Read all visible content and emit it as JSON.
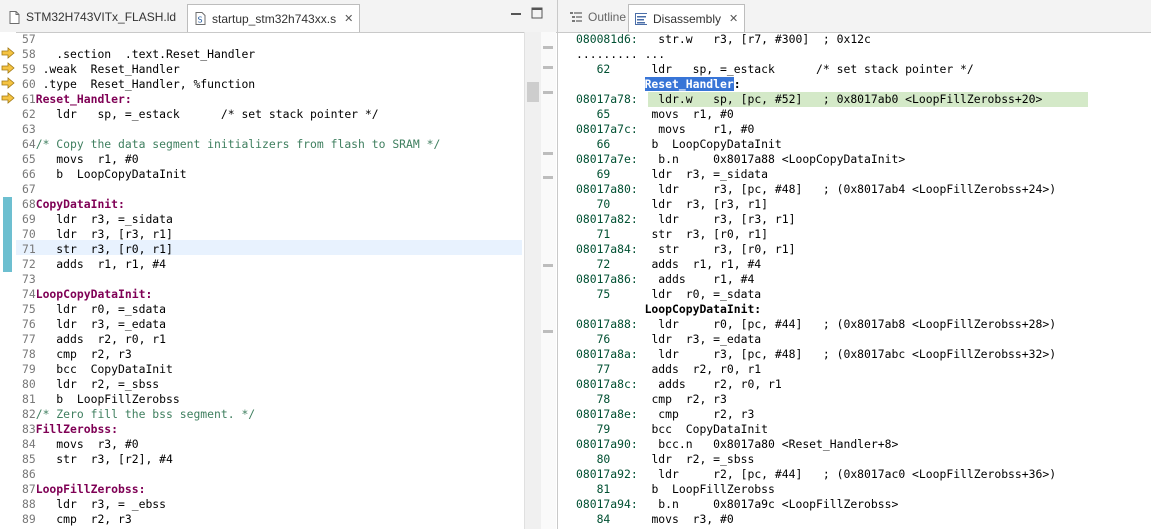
{
  "left": {
    "tabs": [
      {
        "label": "STM32H743VITx_FLASH.ld",
        "active": false
      },
      {
        "label": "startup_stm32h743xx.s",
        "active": true,
        "close": "✕"
      }
    ],
    "lines": [
      {
        "n": "57",
        "t": ""
      },
      {
        "n": "58",
        "t": "  .section  .text.Reset_Handler"
      },
      {
        "n": "59",
        "t": ".weak  Reset_Handler"
      },
      {
        "n": "60",
        "t": ".type  Reset_Handler, %function"
      },
      {
        "n": "61",
        "t": "Reset_Handler:"
      },
      {
        "n": "62",
        "t": "  ldr   sp, =_estack      /* set stack pointer */"
      },
      {
        "n": "63",
        "t": ""
      },
      {
        "n": "64",
        "t": "/* Copy the data segment initializers from flash to SRAM */"
      },
      {
        "n": "65",
        "t": "  movs  r1, #0"
      },
      {
        "n": "66",
        "t": "  b  LoopCopyDataInit"
      },
      {
        "n": "67",
        "t": ""
      },
      {
        "n": "68",
        "t": "CopyDataInit:"
      },
      {
        "n": "69",
        "t": "  ldr  r3, =_sidata"
      },
      {
        "n": "70",
        "t": "  ldr  r3, [r3, r1]"
      },
      {
        "n": "71",
        "t": "  str  r3, [r0, r1]"
      },
      {
        "n": "72",
        "t": "  adds  r1, r1, #4"
      },
      {
        "n": "73",
        "t": ""
      },
      {
        "n": "74",
        "t": "LoopCopyDataInit:"
      },
      {
        "n": "75",
        "t": "  ldr  r0, =_sdata"
      },
      {
        "n": "76",
        "t": "  ldr  r3, =_edata"
      },
      {
        "n": "77",
        "t": "  adds  r2, r0, r1"
      },
      {
        "n": "78",
        "t": "  cmp  r2, r3"
      },
      {
        "n": "79",
        "t": "  bcc  CopyDataInit"
      },
      {
        "n": "80",
        "t": "  ldr  r2, =_sbss"
      },
      {
        "n": "81",
        "t": "  b  LoopFillZerobss"
      },
      {
        "n": "82",
        "t": "/* Zero fill the bss segment. */"
      },
      {
        "n": "83",
        "t": "FillZerobss:"
      },
      {
        "n": "84",
        "t": "  movs  r3, #0"
      },
      {
        "n": "85",
        "t": "  str  r3, [r2], #4"
      },
      {
        "n": "86",
        "t": ""
      },
      {
        "n": "87",
        "t": "LoopFillZerobss:"
      },
      {
        "n": "88",
        "t": "  ldr  r3, = _ebss"
      },
      {
        "n": "89",
        "t": "  cmp  r2, r3"
      }
    ]
  },
  "right": {
    "tabs": [
      {
        "label": "Outline",
        "active": false
      },
      {
        "label": "Disassembly",
        "active": true,
        "close": "✕"
      }
    ],
    "lines": [
      {
        "a": "080081d6:",
        "t": "   str.w   r3, [r7, #300]  ; 0x12c"
      },
      {
        "a": "",
        "t": "......... ..."
      },
      {
        "a": "   62",
        "t": "      ldr   sp, =_estack      /* set stack pointer */"
      },
      {
        "a": "",
        "t": "          Reset_Handler:"
      },
      {
        "a": "08017a78:",
        "t": "   ldr.w   sp, [pc, #52]   ; 0x8017ab0 <LoopFillZerobss+20>"
      },
      {
        "a": "   65",
        "t": "      movs  r1, #0"
      },
      {
        "a": "08017a7c:",
        "t": "   movs    r1, #0"
      },
      {
        "a": "   66",
        "t": "      b  LoopCopyDataInit"
      },
      {
        "a": "08017a7e:",
        "t": "   b.n     0x8017a88 <LoopCopyDataInit>"
      },
      {
        "a": "   69",
        "t": "      ldr  r3, =_sidata"
      },
      {
        "a": "08017a80:",
        "t": "   ldr     r3, [pc, #48]   ; (0x8017ab4 <LoopFillZerobss+24>)"
      },
      {
        "a": "   70",
        "t": "      ldr  r3, [r3, r1]"
      },
      {
        "a": "08017a82:",
        "t": "   ldr     r3, [r3, r1]"
      },
      {
        "a": "   71",
        "t": "      str  r3, [r0, r1]"
      },
      {
        "a": "08017a84:",
        "t": "   str     r3, [r0, r1]"
      },
      {
        "a": "   72",
        "t": "      adds  r1, r1, #4"
      },
      {
        "a": "08017a86:",
        "t": "   adds    r1, #4"
      },
      {
        "a": "   75",
        "t": "      ldr  r0, =_sdata"
      },
      {
        "a": "",
        "t": "          LoopCopyDataInit:"
      },
      {
        "a": "08017a88:",
        "t": "   ldr     r0, [pc, #44]   ; (0x8017ab8 <LoopFillZerobss+28>)"
      },
      {
        "a": "   76",
        "t": "      ldr  r3, =_edata"
      },
      {
        "a": "08017a8a:",
        "t": "   ldr     r3, [pc, #48]   ; (0x8017abc <LoopFillZerobss+32>)"
      },
      {
        "a": "   77",
        "t": "      adds  r2, r0, r1"
      },
      {
        "a": "08017a8c:",
        "t": "   adds    r2, r0, r1"
      },
      {
        "a": "   78",
        "t": "      cmp  r2, r3"
      },
      {
        "a": "08017a8e:",
        "t": "   cmp     r2, r3"
      },
      {
        "a": "   79",
        "t": "      bcc  CopyDataInit"
      },
      {
        "a": "08017a90:",
        "t": "   bcc.n   0x8017a80 <Reset_Handler+8>"
      },
      {
        "a": "   80",
        "t": "      ldr  r2, =_sbss"
      },
      {
        "a": "08017a92:",
        "t": "   ldr     r2, [pc, #44]   ; (0x8017ac0 <LoopFillZerobss+36>)"
      },
      {
        "a": "   81",
        "t": "      b  LoopFillZerobss"
      },
      {
        "a": "08017a94:",
        "t": "   b.n     0x8017a9c <LoopFillZerobss>"
      },
      {
        "a": "   84",
        "t": "      movs  r3, #0"
      }
    ]
  }
}
